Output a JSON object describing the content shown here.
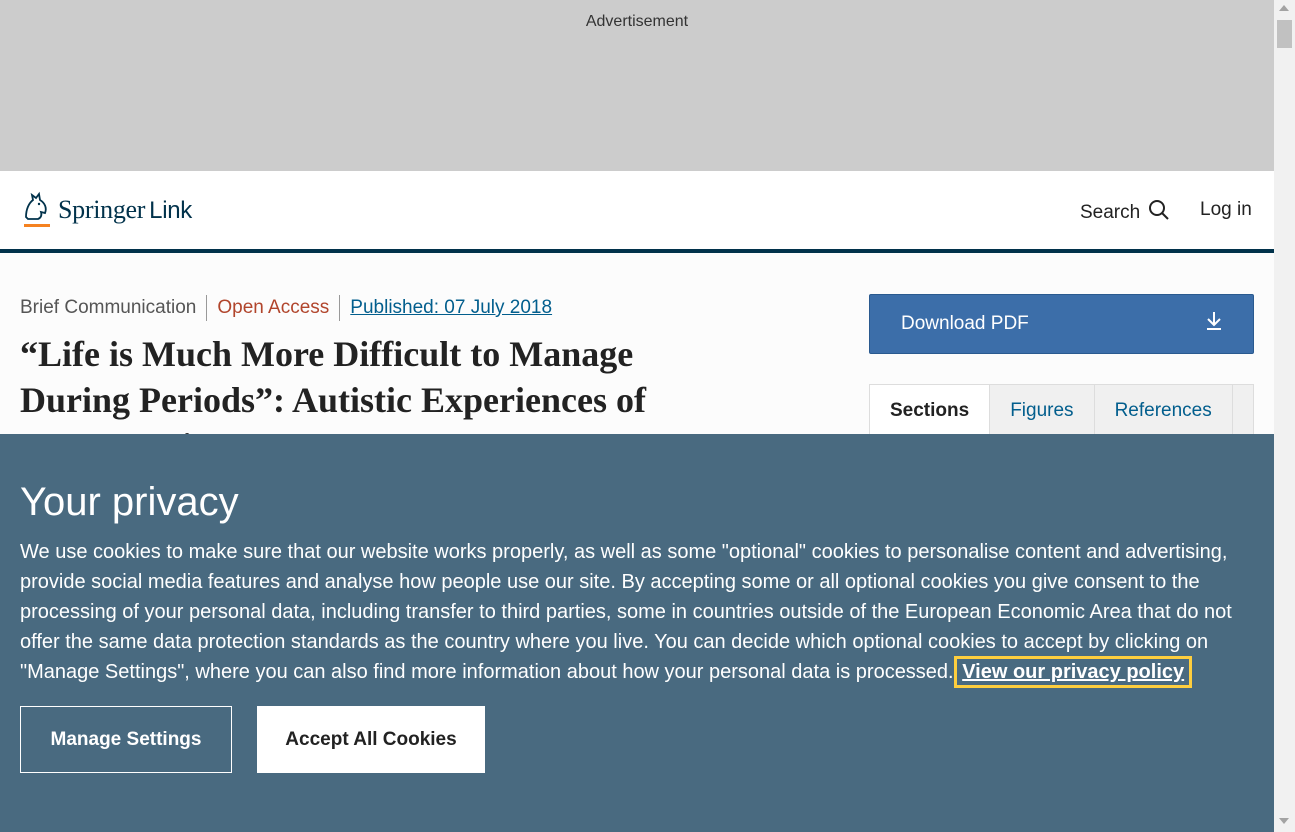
{
  "ad": {
    "label": "Advertisement"
  },
  "header": {
    "logo_brand": "Springer",
    "logo_suffix": "Link",
    "search_label": "Search",
    "login_label": "Log in"
  },
  "article": {
    "type": "Brief Communication",
    "access": "Open Access",
    "published": "Published: 07 July 2018",
    "title": "“Life is Much More Difficult to Manage During Periods”: Autistic Experiences of Menstruation"
  },
  "sidebar": {
    "download_label": "Download PDF",
    "tabs": [
      {
        "label": "Sections"
      },
      {
        "label": "Figures"
      },
      {
        "label": "References"
      }
    ]
  },
  "cookie": {
    "heading": "Your privacy",
    "body": "We use cookies to make sure that our website works properly, as well as some \"optional\" cookies to personalise content and advertising, provide social media features and analyse how people use our site. By accepting some or all optional cookies you give consent to the processing of your personal data, including transfer to third parties, some in countries outside of the European Economic Area that do not offer the same data protection standards as the country where you live. You can decide which optional cookies to accept by clicking on \"Manage Settings\", where you can also find more information about how your personal data is processed.",
    "privacy_link": "View our privacy policy",
    "manage_label": "Manage Settings",
    "accept_label": "Accept All Cookies"
  },
  "colors": {
    "brand_navy": "#01324b",
    "cookie_bg": "#496a80",
    "download_blue": "#3c6ea9",
    "open_access": "#b1452c",
    "focus_yellow": "#fece3e"
  }
}
